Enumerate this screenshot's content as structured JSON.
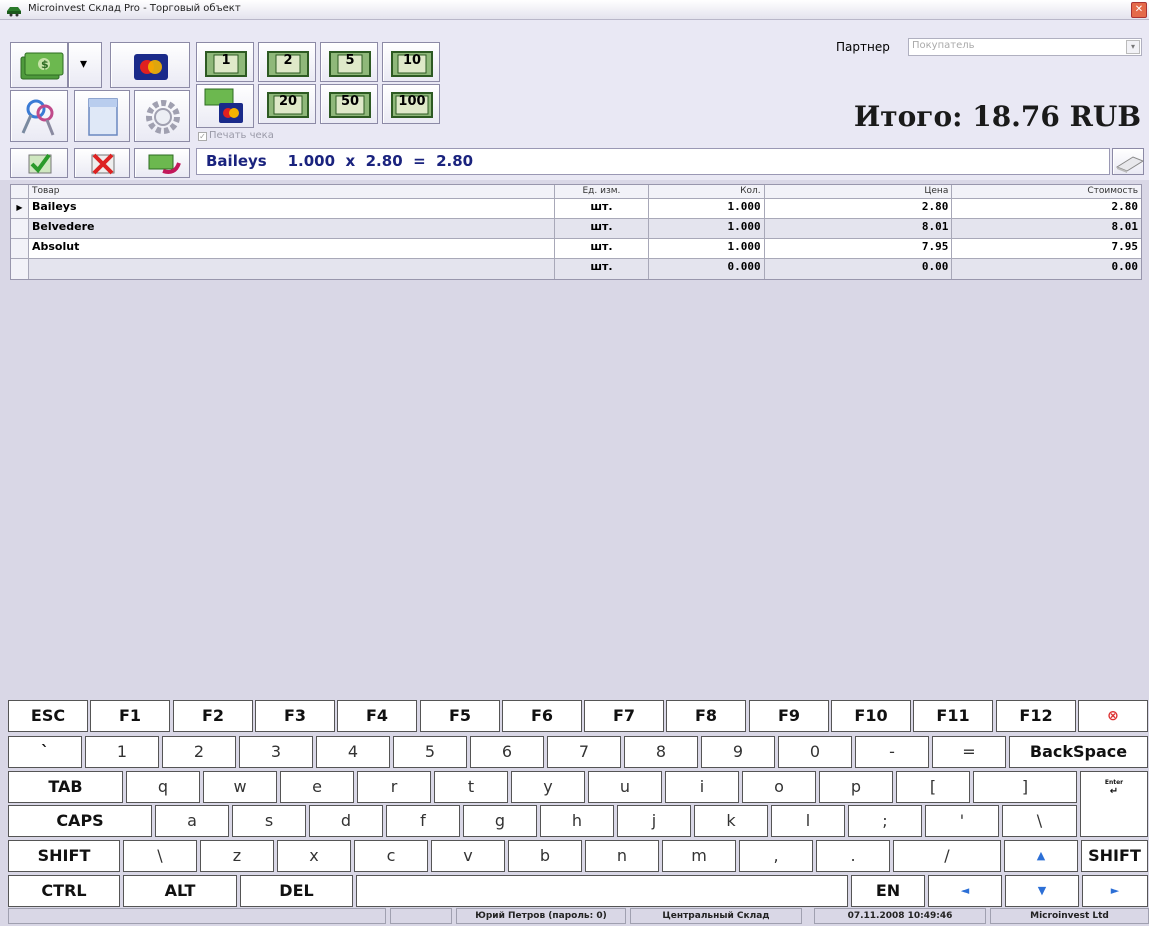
{
  "window": {
    "title": "Microinvest Склад Pro - Торговый объект",
    "close_glyph": "✕"
  },
  "toolbar": {
    "cash_icon": "cash-money-icon",
    "dropdown_glyph": "▾",
    "denominations": [
      "1",
      "2",
      "5",
      "10",
      "20",
      "50",
      "100"
    ],
    "print_receipt_label": "Печать чека",
    "print_receipt_checked": true
  },
  "partner": {
    "label": "Партнер",
    "value": "Покупатель"
  },
  "total": {
    "text": "Итого:  18.76 RUB"
  },
  "info": {
    "text": "Baileys    1.000  x  2.80  =  2.80"
  },
  "grid": {
    "headers": [
      "Товар",
      "Ед. изм.",
      "Кол.",
      "Цена",
      "Стоимость"
    ],
    "rows": [
      {
        "name": "Baileys",
        "unit": "шт.",
        "qty": "1.000",
        "price": "2.80",
        "cost": "2.80"
      },
      {
        "name": "Belvedere",
        "unit": "шт.",
        "qty": "1.000",
        "price": "8.01",
        "cost": "8.01"
      },
      {
        "name": "Absolut",
        "unit": "шт.",
        "qty": "1.000",
        "price": "7.95",
        "cost": "7.95"
      },
      {
        "name": "",
        "unit": "шт.",
        "qty": "0.000",
        "price": "0.00",
        "cost": "0.00"
      }
    ]
  },
  "keyboard": {
    "row1": [
      "ESC",
      "F1",
      "F2",
      "F3",
      "F4",
      "F5",
      "F6",
      "F7",
      "F8",
      "F9",
      "F10",
      "F11",
      "F12",
      "⊗"
    ],
    "row2": [
      "`",
      "1",
      "2",
      "3",
      "4",
      "5",
      "6",
      "7",
      "8",
      "9",
      "0",
      "-",
      "=",
      "BackSpace"
    ],
    "row3": [
      "TAB",
      "q",
      "w",
      "e",
      "r",
      "t",
      "y",
      "u",
      "i",
      "o",
      "p",
      "[",
      "]"
    ],
    "row4": [
      "CAPS",
      "a",
      "s",
      "d",
      "f",
      "g",
      "h",
      "j",
      "k",
      "l",
      ";",
      "'",
      "\\"
    ],
    "enter": "Enter",
    "row5": [
      "SHIFT",
      "\\",
      "z",
      "x",
      "c",
      "v",
      "b",
      "n",
      "m",
      ",",
      ".",
      "/",
      "▲",
      "SHIFT"
    ],
    "row6": [
      "CTRL",
      "ALT",
      "DEL",
      "",
      "EN",
      "◄",
      "▼",
      "►"
    ]
  },
  "status": [
    "",
    "",
    "Юрий Петров (пароль: 0)",
    "Центральный Склад",
    "07.11.2008 10:49:46",
    "Microinvest Ltd"
  ],
  "colors": {
    "background": "#d9d7e6",
    "toolbar": "#e9e8f4",
    "info_text": "#1a237e",
    "arrow_keys": "#2c6fd6"
  }
}
